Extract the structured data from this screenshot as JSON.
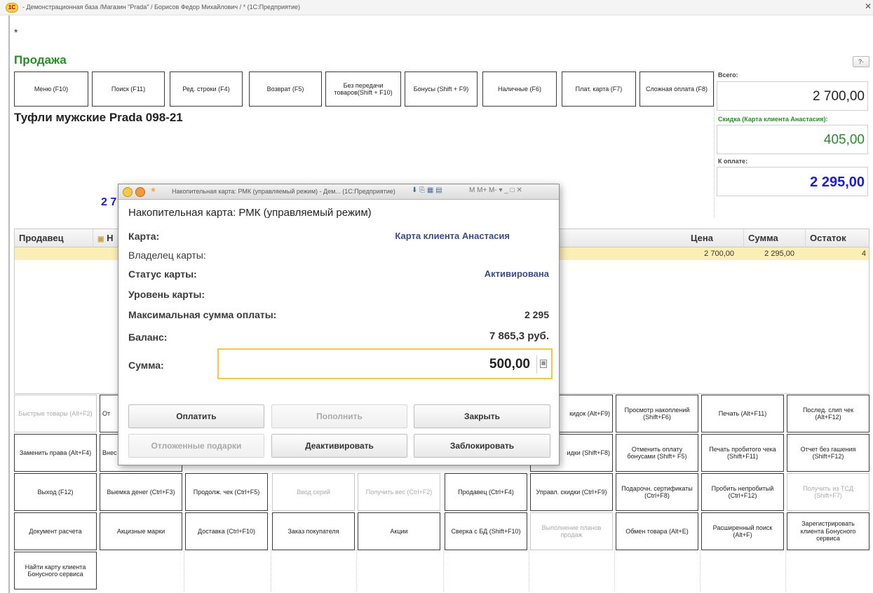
{
  "window": {
    "title": "- Демонстрационная база /Магазин \"Prada\" / Борисов Федор Михайлович / * (1С:Предприятие)",
    "modified_mark": "*"
  },
  "document": {
    "title": "Продажа",
    "help_label": "?·"
  },
  "top_buttons": [
    "Меню (F10)",
    "Поиск (F11)",
    "Ред. строки (F4)",
    "Возврат (F5)",
    "Без передачи товаров(Shift + F10)",
    "Бонусы (Shift + F9)",
    "Наличные (F6)",
    "Плат. карта (F7)",
    "Сложная оплата (F8)"
  ],
  "product": {
    "name": "Туфли мужские Prada 098-21",
    "partial_qty": "2 7"
  },
  "totals": {
    "total_label": "Всего:",
    "total_value": "2 700,00",
    "discount_label": "Скидка (Карта клиента Анастасия):",
    "discount_value": "405,00",
    "pay_label": "К оплате:",
    "pay_value": "2 295,00",
    "colors": {
      "green": "#2a8a2a",
      "blue": "#1c1cd0"
    }
  },
  "grid": {
    "headers": {
      "seller": "Продавец",
      "name_partial": "Н",
      "price": "Цена",
      "sum": "Сумма",
      "rest": "Остаток"
    },
    "row": {
      "name_partial": "Т",
      "price": "2 700,00",
      "sum": "2 295,00",
      "rest": "4"
    }
  },
  "modal": {
    "title": "Накопительная карта: РМК (управляемый режим) - Дем... (1С:Предприятие)",
    "title_icons": "M  M+  M-  ▾  _  □  ✕",
    "heading": "Накопительная карта: РМК (управляемый режим)",
    "fields": {
      "card_label": "Карта:",
      "card_value": "Карта клиента Анастасия",
      "owner_label": "Владелец карты:",
      "status_label": "Статус карты:",
      "status_value": "Активирована",
      "level_label": "Уровень карты:",
      "max_label": "Максимальная сумма оплаты:",
      "max_value": "2 295",
      "balance_label": "Баланс:",
      "balance_value": "7 865,3 руб.",
      "sum_label": "Сумма:",
      "sum_value": "500,00"
    },
    "buttons": {
      "pay": "Оплатить",
      "topup": "Пополнить",
      "close": "Закрыть",
      "deferred": "Отложенные подарки",
      "deactivate": "Деактивировать",
      "block": "Заблокировать"
    }
  },
  "bottom_buttons": {
    "row1": [
      "Быстрые товары (Alt+F2)",
      "От",
      "кидок (Alt+F9)",
      "Просмотр накоплений (Shift+F6)",
      "Печать (Alt+F11)",
      "Послед. слип чек (Alt+F12)"
    ],
    "row2": [
      "Заменить права (Alt+F4)",
      "Внес",
      "идки (Shift+F8)",
      "Отменить оплату бонусами (Shift+ F5)",
      "Печать пробитого чека (Shift+F11)",
      "Отчет без гашения (Shift+F12)"
    ],
    "row3": [
      "Выход (F12)",
      "Выемка денег (Ctrl+F3)",
      "Продолж. чек (Ctrl+F5)",
      "Ввод серий",
      "Получить вес (Ctrl+F2)",
      "Продавец (Ctrl+F4)",
      "Управл. скидки (Ctrl+F9)",
      "Подарочн. сертификаты (Ctrl+F8)",
      "Пробить непробитый (Ctrl+F12)",
      "Получить из ТСД (Shift+F7)"
    ],
    "row4": [
      "Документ расчета",
      "Акцизные марки",
      "Доставка (Ctrl+F10)",
      "Заказ покупателя",
      "Акции",
      "Сверка с БД (Shift+F10)",
      "Выполнение планов продаж",
      "Обмен товара (Alt+E)",
      "Расширенный поиск (Alt+F)",
      "Зарегистрировать клиента Бонусного сервиса"
    ],
    "row5": [
      "Найти карту клиента Бонусного сервиса"
    ]
  }
}
